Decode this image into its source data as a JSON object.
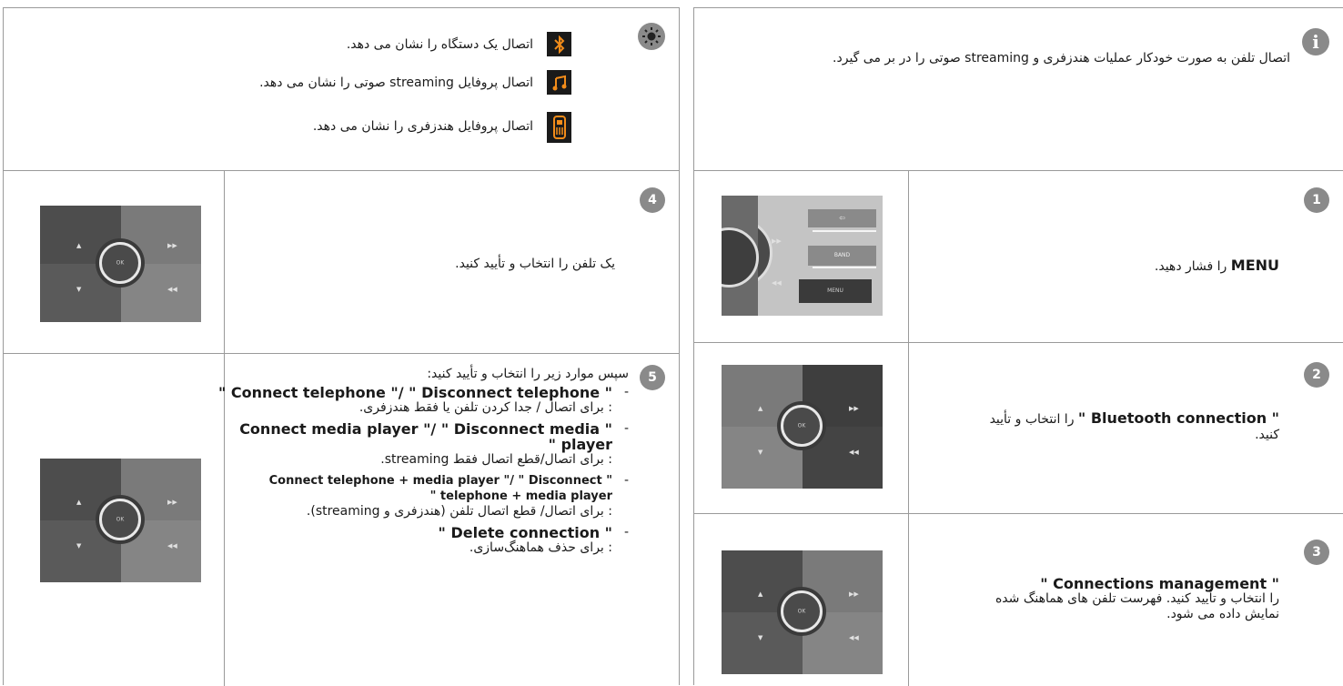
{
  "left": {
    "top": {
      "lines": [
        "اتصال یک دستگاه را نشان می دهد.",
        "اتصال پروفایل streaming صوتی را نشان می دهد.",
        "اتصال پروفایل هندزفری را نشان می دهد."
      ]
    },
    "step4": {
      "number": "4",
      "text": "یک تلفن را انتخاب و تأیید کنید."
    },
    "step5": {
      "number": "5",
      "intro": "سپس موارد زیر را انتخاب و تأیید کنید:",
      "items": [
        {
          "bold": "\" Connect telephone \"/ \" Disconnect telephone \"",
          "text": ": برای اتصال / جدا کردن تلفن یا فقط هندزفری."
        },
        {
          "bold": "\" Connect media player \"/ \" Disconnect media player \"",
          "text": ": برای اتصال/قطع اتصال فقط streaming."
        },
        {
          "bold": "\" Connect telephone + media player \"/ \" Disconnect telephone + media player \"",
          "text": ": برای اتصال/ قطع اتصال تلفن (هندزفری و streaming)."
        },
        {
          "bold": "\" Delete connection \"",
          "text": ": برای حذف هماهنگ‌سازی."
        }
      ]
    }
  },
  "right": {
    "info": {
      "icon": "i",
      "text": "اتصال تلفن به صورت خودکار عملیات هندزفری و streaming صوتی را در بر می گیرد."
    },
    "step1": {
      "number": "1",
      "bold": "MENU",
      "text": " را فشار دهید."
    },
    "step2": {
      "number": "2",
      "bold": "\" Bluetooth connection \"",
      "text": " را انتخاب و تأیید کنید."
    },
    "step3": {
      "number": "3",
      "bold": "\" Connections management \"",
      "text": " را انتخاب و تأیید کنید. فهرست تلفن های هماهنگ شده نمایش داده می شود."
    },
    "panel_labels": {
      "ok": "OK",
      "band": "BAND",
      "menu": "MENU"
    }
  },
  "colors": {
    "accent": "#f28c1a",
    "badge": "#8a8a8a",
    "border": "#9a9a9a"
  }
}
